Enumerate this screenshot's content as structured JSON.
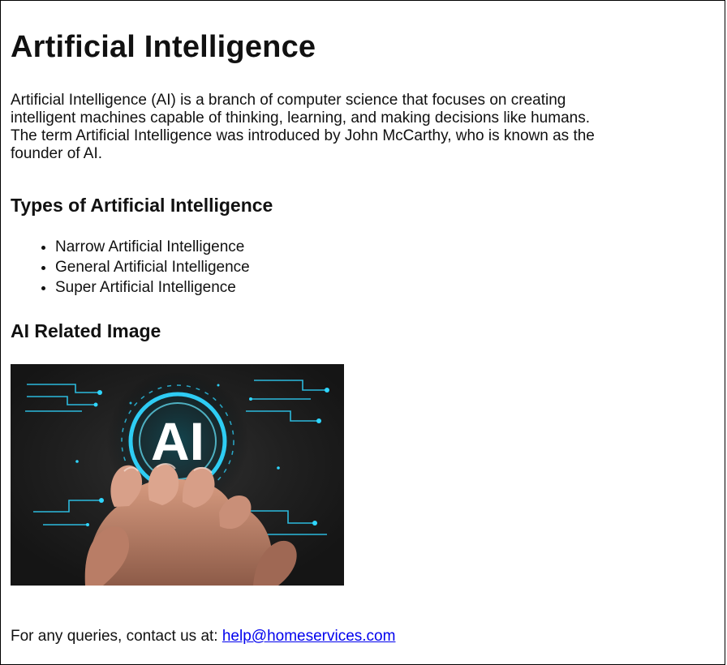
{
  "page": {
    "title": "Artificial Intelligence",
    "intro": "Artificial Intelligence (AI) is a branch of computer science that focuses on creating intelligent machines capable of thinking, learning, and making decisions like humans. The term Artificial Intelligence was introduced by John McCarthy, who is known as the founder of AI."
  },
  "types": {
    "heading": "Types of Artificial Intelligence",
    "items": [
      "Narrow Artificial Intelligence",
      "General Artificial Intelligence",
      "Super Artificial Intelligence"
    ]
  },
  "image_section": {
    "heading": "AI Related Image",
    "image_text": "AI",
    "colors": {
      "background": "#232323",
      "glow": "#2fd6ff",
      "hand": "#c7876a"
    }
  },
  "footer": {
    "prefix": "For any queries, contact us at: ",
    "email": "help@homeservices.com"
  }
}
